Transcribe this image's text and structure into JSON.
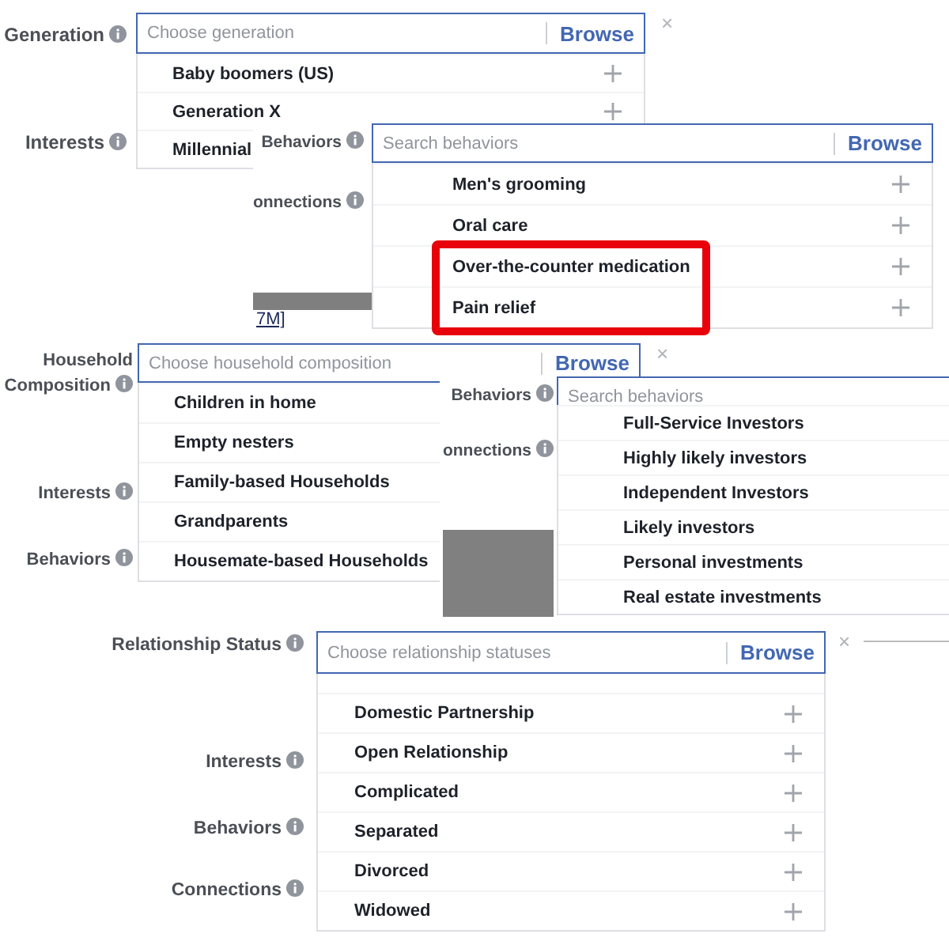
{
  "panels": [
    {
      "labels": [
        {
          "text": "Generation"
        },
        {
          "text": "Interests"
        }
      ],
      "field": {
        "placeholder": "Choose generation",
        "browse": "Browse",
        "close": "×"
      },
      "items": [
        {
          "label": "Baby boomers (US)"
        },
        {
          "label": "Generation X"
        },
        {
          "label": "Millennial"
        }
      ]
    },
    {
      "labels": [
        {
          "text": "Behaviors"
        },
        {
          "text": "onnections"
        }
      ],
      "field": {
        "placeholder": "Search behaviors",
        "browse": "Browse"
      },
      "footer_link": "7M]",
      "items": [
        {
          "label": "Men's grooming"
        },
        {
          "label": "Oral care"
        }
      ],
      "highlight": {
        "items": [
          {
            "label": "Over-the-counter medication"
          },
          {
            "label": "Pain relief"
          }
        ]
      }
    },
    {
      "labels": [
        {
          "text": "Household Composition"
        },
        {
          "text": "Interests"
        },
        {
          "text": "Behaviors"
        }
      ],
      "field": {
        "placeholder": "Choose household composition",
        "browse": "Browse",
        "close": "×"
      },
      "items": [
        {
          "label": "Children in home"
        },
        {
          "label": "Empty nesters"
        },
        {
          "label": "Family-based Households"
        },
        {
          "label": "Grandparents"
        },
        {
          "label": "Housemate-based Households"
        }
      ]
    },
    {
      "labels": [
        {
          "text": "Behaviors"
        },
        {
          "text": "onnections"
        }
      ],
      "field": {
        "placeholder": "Search behaviors"
      },
      "items": [
        {
          "label": "Full-Service Investors"
        },
        {
          "label": "Highly likely investors"
        },
        {
          "label": "Independent Investors"
        },
        {
          "label": "Likely investors"
        },
        {
          "label": "Personal investments"
        },
        {
          "label": "Real estate investments"
        }
      ]
    },
    {
      "labels": [
        {
          "text": "Relationship Status"
        },
        {
          "text": "Interests"
        },
        {
          "text": "Behaviors"
        },
        {
          "text": "Connections"
        }
      ],
      "field": {
        "placeholder": "Choose relationship statuses",
        "browse": "Browse",
        "close": "×"
      },
      "items": [
        {
          "label": "Domestic Partnership"
        },
        {
          "label": "Open Relationship"
        },
        {
          "label": "Complicated"
        },
        {
          "label": "Separated"
        },
        {
          "label": "Divorced"
        },
        {
          "label": "Widowed"
        }
      ]
    }
  ]
}
